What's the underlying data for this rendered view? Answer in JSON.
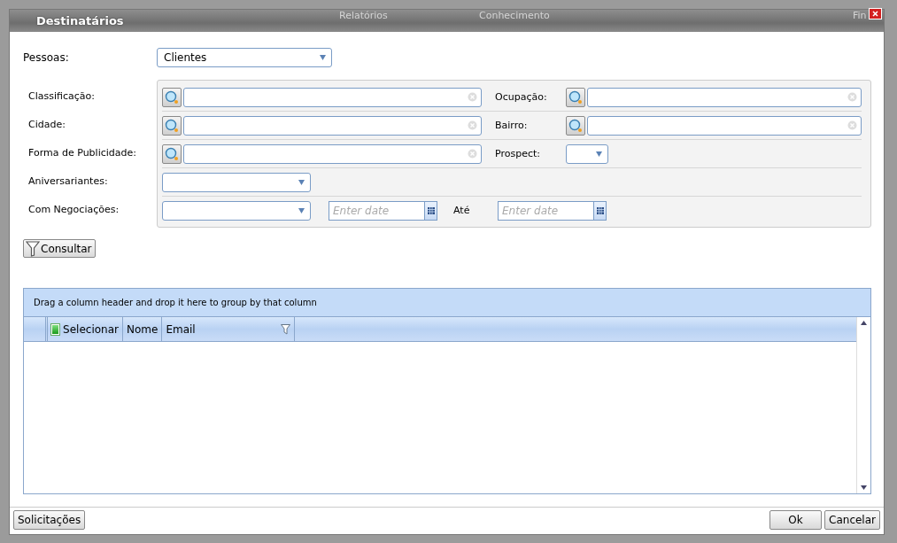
{
  "window": {
    "title": "Destinatários"
  },
  "background_menu": [
    "Relatórios",
    "Conhecimento",
    "Fin"
  ],
  "pessoas": {
    "label": "Pessoas:",
    "value": "Clientes"
  },
  "filters": [
    {
      "label": "Classificação:",
      "kind": "lookup",
      "right": {
        "label": "Ocupação:",
        "kind": "lookup"
      }
    },
    {
      "label": "Cidade:",
      "kind": "lookup",
      "right": {
        "label": "Bairro:",
        "kind": "lookup"
      }
    },
    {
      "label": "Forma de Publicidade:",
      "kind": "lookup",
      "right": {
        "label": "Prospect:",
        "kind": "select"
      }
    },
    {
      "label": "Aniversariantes:",
      "kind": "select"
    },
    {
      "label": "Com Negociações:",
      "kind": "select_daterange",
      "from_placeholder": "Enter date",
      "to_label": "Até",
      "to_placeholder": "Enter date"
    }
  ],
  "consultar": "Consultar",
  "grid": {
    "group_hint": "Drag a column header and drop it here to group by that column",
    "columns": [
      {
        "label": "Selecionar",
        "kind": "select"
      },
      {
        "label": "Nome",
        "kind": "plain"
      },
      {
        "label": "Email",
        "kind": "filter"
      }
    ]
  },
  "footer": {
    "left_buttons": [
      "Solicitações"
    ],
    "right_buttons": [
      "Ok",
      "Cancelar"
    ]
  }
}
